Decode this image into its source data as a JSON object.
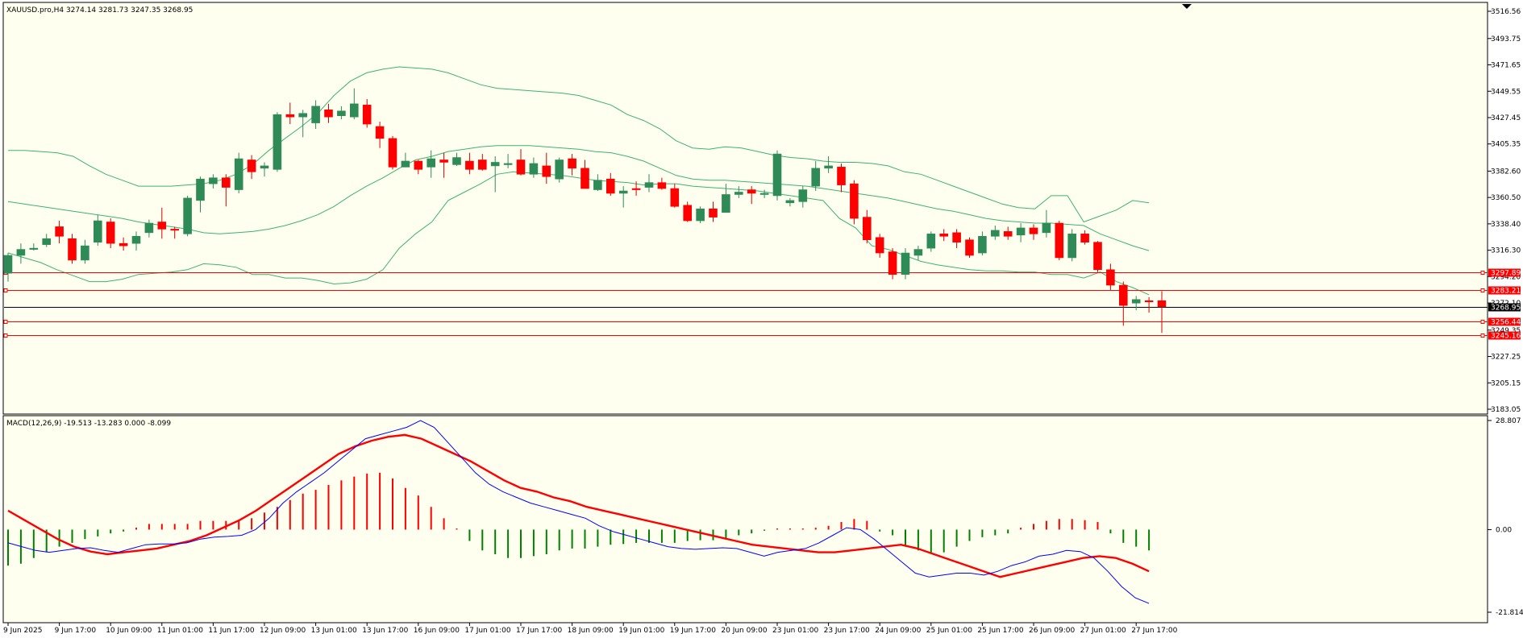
{
  "chart_data": [
    {
      "type": "candlestick",
      "title": "XAUUSD.pro,H4  3274.14 3281.73 3247.35 3268.95",
      "ylim": [
        3183.05,
        3516.56
      ],
      "y_ticks": [
        "3516.56",
        "3493.75",
        "3471.65",
        "3449.55",
        "3427.45",
        "3405.35",
        "3382.60",
        "3360.50",
        "3338.40",
        "3316.30",
        "3294.20",
        "3272.10",
        "3249.35",
        "3227.25",
        "3205.15",
        "3183.05"
      ],
      "x_ticks": [
        "9 Jun 2025",
        "9 Jun 17:00",
        "10 Jun 09:00",
        "11 Jun 01:00",
        "11 Jun 17:00",
        "12 Jun 09:00",
        "13 Jun 01:00",
        "13 Jun 17:00",
        "16 Jun 09:00",
        "17 Jun 01:00",
        "17 Jun 17:00",
        "18 Jun 09:00",
        "19 Jun 01:00",
        "19 Jun 17:00",
        "20 Jun 09:00",
        "23 Jun 01:00",
        "23 Jun 17:00",
        "24 Jun 09:00",
        "25 Jun 01:00",
        "25 Jun 17:00",
        "26 Jun 09:00",
        "27 Jun 01:00",
        "27 Jun 17:00"
      ],
      "x_tick_candle_index": [
        0,
        4,
        8,
        12,
        16,
        20,
        24,
        28,
        32,
        36,
        40,
        44,
        48,
        52,
        56,
        60,
        64,
        68,
        72,
        76,
        80,
        84,
        88
      ],
      "candles": [
        [
          3297,
          3312,
          3290,
          3314
        ],
        [
          3312,
          3317,
          3305,
          3322
        ],
        [
          3318,
          3318,
          3316,
          3322
        ],
        [
          3321,
          3326,
          3319,
          3330
        ],
        [
          3336,
          3328,
          3322,
          3341
        ],
        [
          3326,
          3308,
          3305,
          3330
        ],
        [
          3308,
          3320,
          3305,
          3325
        ],
        [
          3323,
          3341,
          3320,
          3346
        ],
        [
          3340,
          3322,
          3318,
          3343
        ],
        [
          3322,
          3320,
          3316,
          3327
        ],
        [
          3322,
          3328,
          3316,
          3332
        ],
        [
          3331,
          3339,
          3327,
          3342
        ],
        [
          3340,
          3334,
          3326,
          3352
        ],
        [
          3334,
          3333,
          3326,
          3336
        ],
        [
          3330,
          3360,
          3328,
          3362
        ],
        [
          3358,
          3376,
          3348,
          3378
        ],
        [
          3372,
          3377,
          3368,
          3380
        ],
        [
          3377,
          3369,
          3353,
          3380
        ],
        [
          3367,
          3393,
          3364,
          3398
        ],
        [
          3392,
          3382,
          3376,
          3396
        ],
        [
          3385,
          3387,
          3378,
          3390
        ],
        [
          3384,
          3430,
          3382,
          3432
        ],
        [
          3430,
          3428,
          3422,
          3440
        ],
        [
          3428,
          3431,
          3411,
          3434
        ],
        [
          3423,
          3437,
          3418,
          3442
        ],
        [
          3434,
          3428,
          3423,
          3439
        ],
        [
          3429,
          3433,
          3426,
          3437
        ],
        [
          3428,
          3439,
          3426,
          3452
        ],
        [
          3438,
          3422,
          3419,
          3443
        ],
        [
          3420,
          3410,
          3402,
          3424
        ],
        [
          3410,
          3386,
          3384,
          3412
        ],
        [
          3386,
          3391,
          3386,
          3398
        ],
        [
          3391,
          3384,
          3380,
          3392
        ],
        [
          3386,
          3393,
          3377,
          3400
        ],
        [
          3392,
          3390,
          3377,
          3398
        ],
        [
          3388,
          3394,
          3387,
          3398
        ],
        [
          3391,
          3384,
          3380,
          3398
        ],
        [
          3392,
          3384,
          3383,
          3397
        ],
        [
          3387,
          3390,
          3365,
          3395
        ],
        [
          3389,
          3389,
          3385,
          3397
        ],
        [
          3392,
          3380,
          3379,
          3401
        ],
        [
          3380,
          3389,
          3377,
          3394
        ],
        [
          3387,
          3378,
          3372,
          3398
        ],
        [
          3376,
          3392,
          3373,
          3394
        ],
        [
          3393,
          3385,
          3379,
          3397
        ],
        [
          3385,
          3368,
          3368,
          3392
        ],
        [
          3367,
          3375,
          3366,
          3380
        ],
        [
          3376,
          3364,
          3362,
          3381
        ],
        [
          3364,
          3366,
          3352,
          3370
        ],
        [
          3368,
          3367,
          3362,
          3374
        ],
        [
          3369,
          3373,
          3365,
          3380
        ],
        [
          3373,
          3368,
          3367,
          3377
        ],
        [
          3368,
          3353,
          3352,
          3372
        ],
        [
          3354,
          3341,
          3340,
          3357
        ],
        [
          3341,
          3351,
          3339,
          3353
        ],
        [
          3351,
          3344,
          3340,
          3357
        ],
        [
          3348,
          3363,
          3348,
          3372
        ],
        [
          3363,
          3365,
          3360,
          3370
        ],
        [
          3367,
          3364,
          3355,
          3370
        ],
        [
          3364,
          3364,
          3360,
          3367
        ],
        [
          3362,
          3397,
          3358,
          3400
        ],
        [
          3356,
          3358,
          3353,
          3360
        ],
        [
          3357,
          3367,
          3352,
          3370
        ],
        [
          3370,
          3385,
          3366,
          3391
        ],
        [
          3385,
          3387,
          3381,
          3395
        ],
        [
          3386,
          3371,
          3365,
          3389
        ],
        [
          3372,
          3343,
          3338,
          3375
        ],
        [
          3344,
          3325,
          3322,
          3350
        ],
        [
          3327,
          3314,
          3310,
          3330
        ],
        [
          3315,
          3296,
          3292,
          3318
        ],
        [
          3296,
          3314,
          3292,
          3318
        ],
        [
          3312,
          3317,
          3308,
          3320
        ],
        [
          3318,
          3330,
          3315,
          3332
        ],
        [
          3330,
          3328,
          3324,
          3334
        ],
        [
          3331,
          3323,
          3318,
          3334
        ],
        [
          3325,
          3312,
          3310,
          3327
        ],
        [
          3314,
          3328,
          3312,
          3332
        ],
        [
          3328,
          3333,
          3325,
          3337
        ],
        [
          3332,
          3328,
          3325,
          3336
        ],
        [
          3329,
          3335,
          3323,
          3339
        ],
        [
          3335,
          3330,
          3325,
          3338
        ],
        [
          3331,
          3339,
          3327,
          3350
        ],
        [
          3339,
          3310,
          3308,
          3341
        ],
        [
          3310,
          3330,
          3307,
          3334
        ],
        [
          3330,
          3323,
          3321,
          3333
        ],
        [
          3323,
          3300,
          3298,
          3324
        ],
        [
          3300,
          3287,
          3283,
          3305
        ],
        [
          3287,
          3270,
          3253,
          3290
        ],
        [
          3272,
          3275,
          3266,
          3278
        ],
        [
          3274,
          3273,
          3264,
          3277
        ],
        [
          3274,
          3269,
          3247,
          3282
        ]
      ],
      "bollinger": {
        "upper": [
          3400,
          3400,
          3399,
          3398,
          3395,
          3387,
          3380,
          3375,
          3370,
          3370,
          3370,
          3371,
          3372,
          3375,
          3380,
          3388,
          3400,
          3410,
          3420,
          3431,
          3446,
          3458,
          3465,
          3468,
          3470,
          3469,
          3468,
          3465,
          3460,
          3455,
          3452,
          3451,
          3450,
          3449,
          3448,
          3446,
          3442,
          3438,
          3430,
          3425,
          3418,
          3408,
          3402,
          3401,
          3403,
          3402,
          3399,
          3396,
          3394,
          3393,
          3391,
          3390,
          3390,
          3389,
          3387,
          3382,
          3380,
          3375,
          3370,
          3365,
          3360,
          3355,
          3352,
          3351,
          3362,
          3362,
          3340,
          3345,
          3350,
          3358,
          3356
        ],
        "middle": [
          3357,
          3355,
          3353,
          3351,
          3349,
          3347,
          3345,
          3343,
          3340,
          3338,
          3336,
          3334,
          3331,
          3330,
          3331,
          3332,
          3334,
          3337,
          3341,
          3346,
          3353,
          3362,
          3370,
          3377,
          3385,
          3392,
          3395,
          3399,
          3401,
          3403,
          3404,
          3404,
          3404,
          3403,
          3402,
          3401,
          3399,
          3398,
          3395,
          3391,
          3385,
          3379,
          3376,
          3375,
          3375,
          3374,
          3373,
          3372,
          3371,
          3370,
          3368,
          3366,
          3364,
          3362,
          3360,
          3357,
          3354,
          3351,
          3349,
          3346,
          3343,
          3341,
          3340,
          3339,
          3339,
          3338,
          3337,
          3330,
          3325,
          3320,
          3316
        ],
        "lower": [
          3314,
          3310,
          3306,
          3300,
          3295,
          3290,
          3290,
          3292,
          3296,
          3297,
          3298,
          3300,
          3305,
          3304,
          3302,
          3296,
          3296,
          3293,
          3293,
          3291,
          3288,
          3289,
          3292,
          3300,
          3318,
          3330,
          3340,
          3358,
          3365,
          3372,
          3380,
          3382,
          3381,
          3380,
          3379,
          3377,
          3375,
          3374,
          3373,
          3371,
          3372,
          3372,
          3370,
          3369,
          3368,
          3367,
          3366,
          3364,
          3362,
          3360,
          3358,
          3343,
          3335,
          3320,
          3317,
          3312,
          3307,
          3304,
          3302,
          3300,
          3299,
          3299,
          3298,
          3298,
          3296,
          3296,
          3293,
          3298,
          3290,
          3285,
          3279
        ],
        "start_index": 0,
        "end_index": 89
      },
      "levels": [
        {
          "label": "3297.89",
          "value": 3297.89
        },
        {
          "label": "3283.21",
          "value": 3283.21
        },
        {
          "label": "3268.95",
          "value": 3268.95,
          "current": true
        },
        {
          "label": "3256.44",
          "value": 3256.44
        },
        {
          "label": "3245.16",
          "value": 3245.16
        }
      ]
    },
    {
      "type": "macd",
      "title": "MACD(12,26,9) -19.513 -13.283 0.000 -8.099",
      "ylim": [
        -21.814,
        28.807
      ],
      "y_ticks": [
        "28.807",
        "0.00",
        "-21.814"
      ],
      "histogram": [
        -9.5,
        -9.0,
        -7.5,
        -6.0,
        -4.5,
        -3.5,
        -2.5,
        -1.8,
        -1.0,
        -0.5,
        0.5,
        1.5,
        1.5,
        1.5,
        1.5,
        2.3,
        2.3,
        2.3,
        2.3,
        3.0,
        4.5,
        6.0,
        7.8,
        9.5,
        10.5,
        11.8,
        13.0,
        14.0,
        14.8,
        15.0,
        13.5,
        11.0,
        9.0,
        6.0,
        3.0,
        0.3,
        -3.0,
        -5.5,
        -6.5,
        -7.5,
        -7.5,
        -7.0,
        -6.5,
        -5.5,
        -5.0,
        -5.0,
        -4.5,
        -4.0,
        -3.8,
        -3.5,
        -3.5,
        -3.5,
        -3.5,
        -3.0,
        -2.8,
        -2.8,
        -2.5,
        -1.5,
        -1.0,
        -0.3,
        0.3,
        0.3,
        0.3,
        0.5,
        1.0,
        2.0,
        2.8,
        2.3,
        -0.5,
        -1.5,
        -4.5,
        -5.5,
        -6.0,
        -6.0,
        -4.5,
        -3.0,
        -2.0,
        -1.5,
        -1.0,
        0.5,
        1.5,
        2.3,
        2.8,
        2.8,
        2.5,
        2.0,
        -1.0,
        -3.5,
        -4.5,
        -5.5
      ],
      "macd": [
        -3.5,
        -4.5,
        -5.5,
        -6.0,
        -5.5,
        -5.0,
        -4.8,
        -5.5,
        -6.0,
        -5.0,
        -4.0,
        -3.8,
        -3.8,
        -3.5,
        -2.5,
        -2.0,
        -1.8,
        -1.5,
        0,
        3.0,
        7.0,
        10.0,
        12.5,
        15.0,
        18.0,
        21.0,
        24.0,
        25.0,
        26.0,
        27.0,
        28.8,
        27.0,
        23.0,
        19.0,
        15.0,
        12.0,
        10.0,
        8.5,
        7.0,
        6.0,
        5.0,
        4.0,
        3.0,
        1.0,
        -0.5,
        -1.5,
        -2.5,
        -3.5,
        -4.5,
        -5.0,
        -5.2,
        -5.0,
        -4.8,
        -5.0,
        -6.0,
        -7.0,
        -6.0,
        -5.5,
        -5.0,
        -3.5,
        -1.5,
        0.5,
        0,
        -2.5,
        -5.5,
        -8.5,
        -11.5,
        -12.5,
        -12.0,
        -11.5,
        -11.5,
        -12.0,
        -11.0,
        -9.5,
        -8.5,
        -7.0,
        -6.5,
        -5.5,
        -5.8,
        -7.5,
        -11.0,
        -15.0,
        -18.0,
        -19.5
      ],
      "signal": [
        5.0,
        2.5,
        0,
        -2.5,
        -4.5,
        -5.8,
        -6.5,
        -6.0,
        -5.5,
        -5.0,
        -4.0,
        -3.0,
        -1.5,
        0.5,
        2.5,
        5.0,
        8.0,
        11.0,
        14.0,
        17.0,
        20.0,
        22.0,
        23.5,
        24.5,
        25.0,
        24.0,
        22.0,
        20.0,
        18.0,
        15.5,
        13.0,
        11.0,
        10.0,
        8.5,
        7.5,
        6.0,
        5.0,
        4.0,
        3.0,
        2.0,
        1.0,
        0,
        -1.0,
        -2.0,
        -3.0,
        -4.0,
        -4.5,
        -5.0,
        -5.5,
        -6.0,
        -6.0,
        -5.5,
        -5.0,
        -4.5,
        -4.0,
        -5.0,
        -6.5,
        -8.0,
        -9.5,
        -11.0,
        -12.5,
        -11.5,
        -10.5,
        -9.5,
        -8.5,
        -7.5,
        -7.0,
        -7.5,
        -9.0,
        -11.0
      ]
    }
  ]
}
